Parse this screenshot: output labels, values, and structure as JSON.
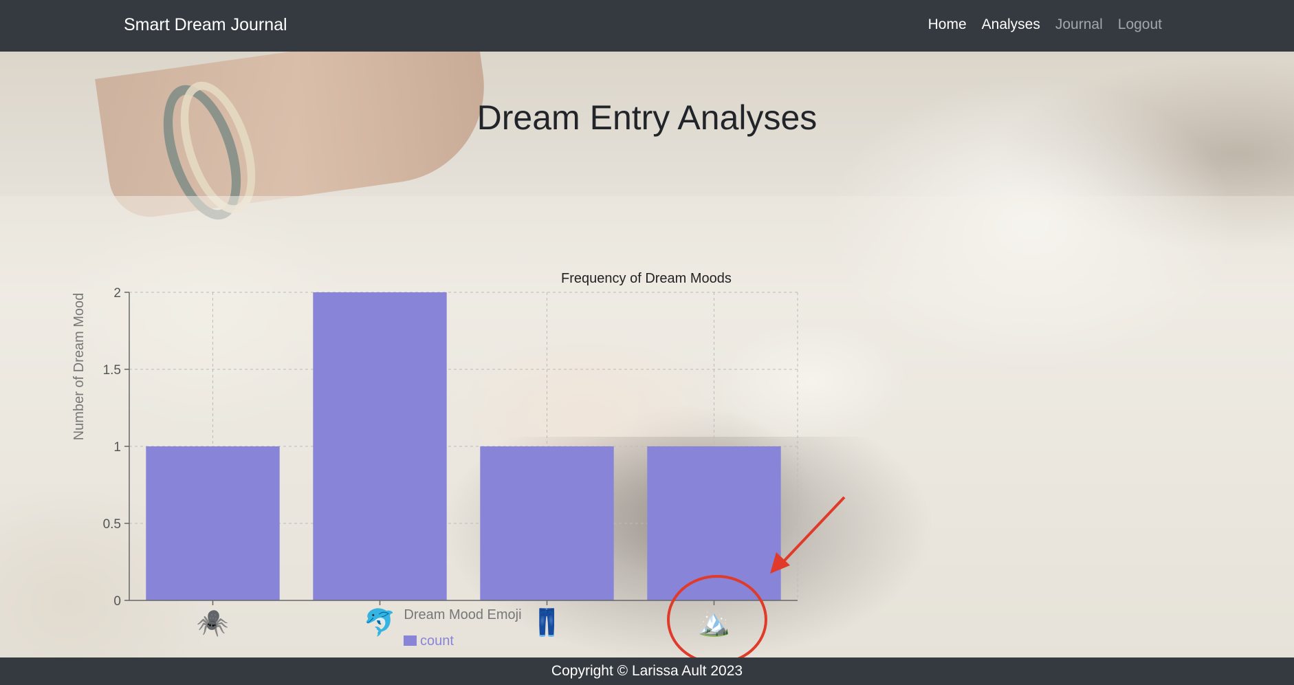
{
  "navbar": {
    "brand": "Smart Dream Journal",
    "links": [
      {
        "label": "Home",
        "state": "active"
      },
      {
        "label": "Analyses",
        "state": "active"
      },
      {
        "label": "Journal",
        "state": "muted"
      },
      {
        "label": "Logout",
        "state": "muted"
      }
    ]
  },
  "page": {
    "heading": "Dream Entry Analyses"
  },
  "chart_data": {
    "type": "bar",
    "title": "Frequency of Dream Moods",
    "xlabel": "Dream Mood Emoji",
    "ylabel": "Number of Dream Mood",
    "categories": [
      "🕷️",
      "🐬",
      "👖",
      "🏔️"
    ],
    "series": [
      {
        "name": "count",
        "values": [
          1,
          2,
          1,
          1
        ],
        "color": "#8884d8"
      }
    ],
    "ylim": [
      0,
      2
    ],
    "yticks": [
      "0",
      "0.5",
      "1",
      "1.5",
      "2"
    ],
    "grid": true,
    "legend": "bottom"
  },
  "annotation": {
    "color": "#e03a2a",
    "target": "🏔️"
  },
  "footer": {
    "text": "Copyright © Larissa Ault 2023"
  },
  "colors": {
    "navbar_bg": "#343a40",
    "bar": "#8884d8"
  }
}
